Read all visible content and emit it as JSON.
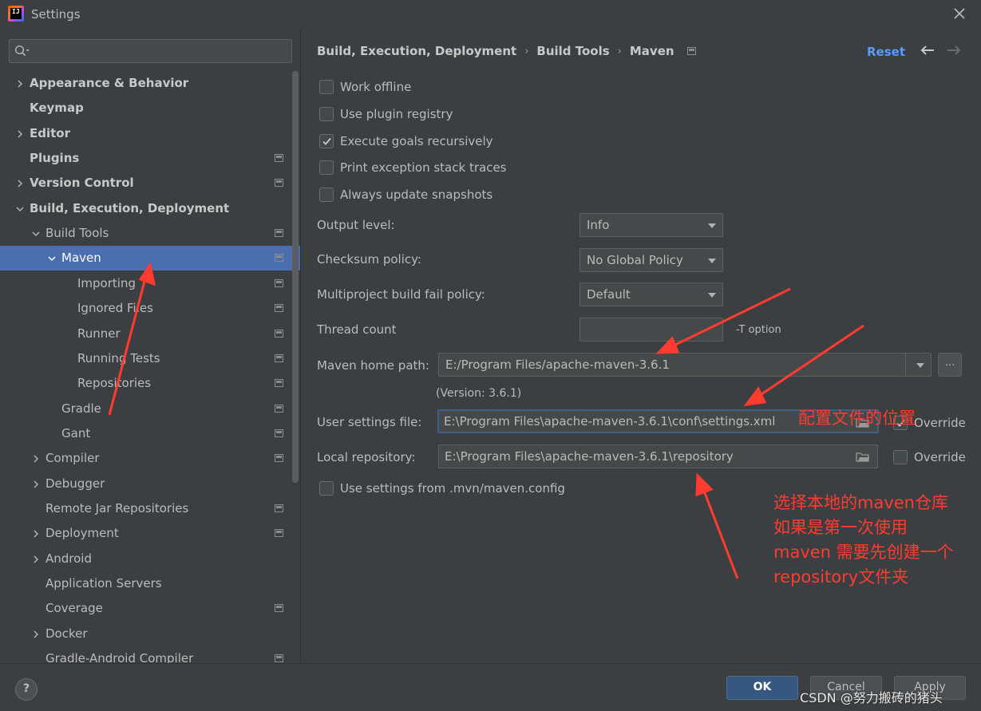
{
  "window": {
    "title": "Settings",
    "icon_text": "IJ"
  },
  "sidebar": {
    "search_placeholder": "",
    "items": [
      {
        "label": "Appearance & Behavior",
        "level": 0,
        "bold": true,
        "chevron": "right",
        "project": false
      },
      {
        "label": "Keymap",
        "level": 0,
        "bold": true,
        "chevron": "none",
        "project": false
      },
      {
        "label": "Editor",
        "level": 0,
        "bold": true,
        "chevron": "right",
        "project": false
      },
      {
        "label": "Plugins",
        "level": 0,
        "bold": true,
        "chevron": "none",
        "project": true
      },
      {
        "label": "Version Control",
        "level": 0,
        "bold": true,
        "chevron": "right",
        "project": true
      },
      {
        "label": "Build, Execution, Deployment",
        "level": 0,
        "bold": true,
        "chevron": "down",
        "project": false
      },
      {
        "label": "Build Tools",
        "level": 1,
        "bold": false,
        "chevron": "down",
        "project": true
      },
      {
        "label": "Maven",
        "level": 2,
        "bold": false,
        "chevron": "down",
        "project": true,
        "selected": true
      },
      {
        "label": "Importing",
        "level": 3,
        "bold": false,
        "chevron": "none",
        "project": true
      },
      {
        "label": "Ignored Files",
        "level": 3,
        "bold": false,
        "chevron": "none",
        "project": true
      },
      {
        "label": "Runner",
        "level": 3,
        "bold": false,
        "chevron": "none",
        "project": true
      },
      {
        "label": "Running Tests",
        "level": 3,
        "bold": false,
        "chevron": "none",
        "project": true
      },
      {
        "label": "Repositories",
        "level": 3,
        "bold": false,
        "chevron": "none",
        "project": true
      },
      {
        "label": "Gradle",
        "level": 2,
        "bold": false,
        "chevron": "none",
        "project": true
      },
      {
        "label": "Gant",
        "level": 2,
        "bold": false,
        "chevron": "none",
        "project": true
      },
      {
        "label": "Compiler",
        "level": 1,
        "bold": false,
        "chevron": "right",
        "project": true
      },
      {
        "label": "Debugger",
        "level": 1,
        "bold": false,
        "chevron": "right",
        "project": false
      },
      {
        "label": "Remote Jar Repositories",
        "level": 1,
        "bold": false,
        "chevron": "none",
        "project": true
      },
      {
        "label": "Deployment",
        "level": 1,
        "bold": false,
        "chevron": "right",
        "project": true
      },
      {
        "label": "Android",
        "level": 1,
        "bold": false,
        "chevron": "right",
        "project": false
      },
      {
        "label": "Application Servers",
        "level": 1,
        "bold": false,
        "chevron": "none",
        "project": false
      },
      {
        "label": "Coverage",
        "level": 1,
        "bold": false,
        "chevron": "none",
        "project": true
      },
      {
        "label": "Docker",
        "level": 1,
        "bold": false,
        "chevron": "right",
        "project": false
      },
      {
        "label": "Gradle-Android Compiler",
        "level": 1,
        "bold": false,
        "chevron": "none",
        "project": true
      }
    ]
  },
  "header": {
    "breadcrumb": [
      "Build, Execution, Deployment",
      "Build Tools",
      "Maven"
    ],
    "separator": "›",
    "reset_label": "Reset"
  },
  "options": {
    "checkboxes": [
      {
        "label": "Work offline",
        "checked": false
      },
      {
        "label": "Use plugin registry",
        "checked": false
      },
      {
        "label": "Execute goals recursively",
        "checked": true
      },
      {
        "label": "Print exception stack traces",
        "checked": false
      },
      {
        "label": "Always update snapshots",
        "checked": false
      }
    ],
    "output_level": {
      "label": "Output level:",
      "value": "Info"
    },
    "checksum_policy": {
      "label": "Checksum policy:",
      "value": "No Global Policy"
    },
    "multiproject_policy": {
      "label": "Multiproject build fail policy:",
      "value": "Default"
    },
    "thread_count": {
      "label": "Thread count",
      "value": "",
      "hint": "-T option"
    },
    "maven_home": {
      "label": "Maven home path:",
      "value": "E:/Program Files/apache-maven-3.6.1",
      "browse": "...",
      "version": "(Version: 3.6.1)"
    },
    "user_settings": {
      "label": "User settings file:",
      "value": "E:\\Program Files\\apache-maven-3.6.1\\conf\\settings.xml",
      "override_label": "Override",
      "override_checked": true
    },
    "local_repo": {
      "label": "Local repository:",
      "value": "E:\\Program Files\\apache-maven-3.6.1\\repository",
      "override_label": "Override",
      "override_checked": false
    },
    "mvn_config": {
      "label": "Use settings from .mvn/maven.config",
      "checked": false
    }
  },
  "footer": {
    "help": "?",
    "ok_label": "OK",
    "cancel_label": "Cancel",
    "apply_label": "Apply"
  },
  "annotations": {
    "settings_note": "配置文件的位置",
    "repo_note_lines": [
      "选择本地的maven仓库",
      "如果是第一次使用",
      "maven 需要先创建一个",
      "repository文件夹"
    ],
    "watermark": "CSDN @努力搬砖的猪头",
    "color": "#ff3b30"
  },
  "colors": {
    "background": "#3c3f41",
    "selection": "#4b6eaf",
    "link": "#589df6",
    "primary_button": "#365880"
  }
}
